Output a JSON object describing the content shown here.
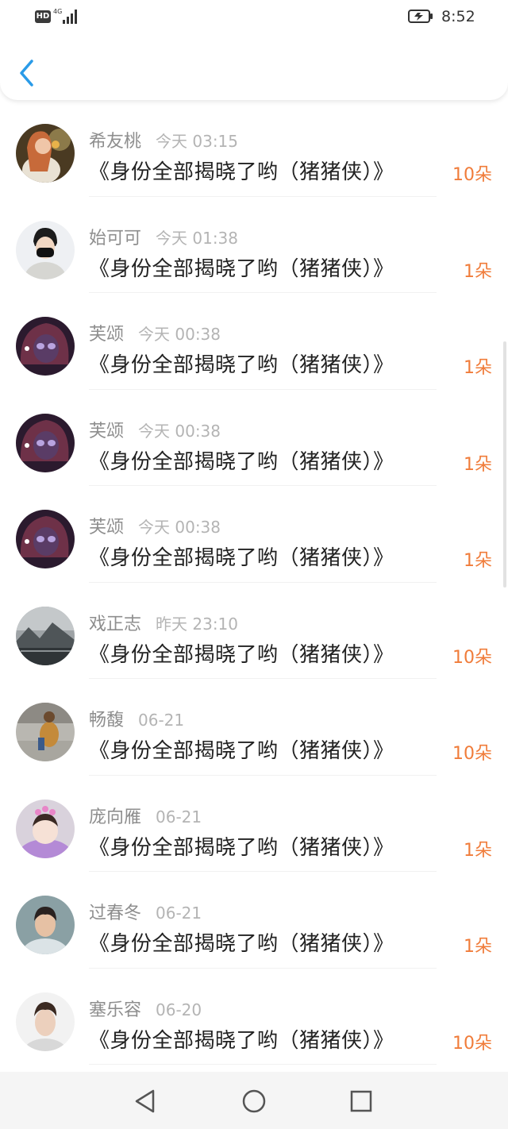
{
  "status_bar": {
    "hd": "HD",
    "network": "4G",
    "time": "8:52"
  },
  "header": {
    "back_icon": "chevron-left-icon",
    "accent_color": "#2a9be8"
  },
  "colors": {
    "count": "#f07c3a",
    "name": "#8e8e8e",
    "time": "#b4b4b4"
  },
  "items": [
    {
      "name": "希友桃",
      "time": "今天 03:15",
      "title": "《身份全部揭晓了哟（猪猪侠）》",
      "count": "10朵"
    },
    {
      "name": "始可可",
      "time": "今天 01:38",
      "title": "《身份全部揭晓了哟（猪猪侠）》",
      "count": "1朵"
    },
    {
      "name": "芙颂",
      "time": "今天 00:38",
      "title": "《身份全部揭晓了哟（猪猪侠）》",
      "count": "1朵"
    },
    {
      "name": "芙颂",
      "time": "今天 00:38",
      "title": "《身份全部揭晓了哟（猪猪侠）》",
      "count": "1朵"
    },
    {
      "name": "芙颂",
      "time": "今天 00:38",
      "title": "《身份全部揭晓了哟（猪猪侠）》",
      "count": "1朵"
    },
    {
      "name": "戏正志",
      "time": "昨天 23:10",
      "title": "《身份全部揭晓了哟（猪猪侠）》",
      "count": "10朵"
    },
    {
      "name": "畅馥",
      "time": "06-21",
      "title": "《身份全部揭晓了哟（猪猪侠）》",
      "count": "10朵"
    },
    {
      "name": "庞向雁",
      "time": "06-21",
      "title": "《身份全部揭晓了哟（猪猪侠）》",
      "count": "1朵"
    },
    {
      "name": "过春冬",
      "time": "06-21",
      "title": "《身份全部揭晓了哟（猪猪侠）》",
      "count": "1朵"
    },
    {
      "name": "塞乐容",
      "time": "06-20",
      "title": "《身份全部揭晓了哟（猪猪侠）》",
      "count": "10朵"
    }
  ],
  "navigation": {
    "back": "triangle-back-icon",
    "home": "circle-home-icon",
    "recents": "square-recents-icon"
  }
}
